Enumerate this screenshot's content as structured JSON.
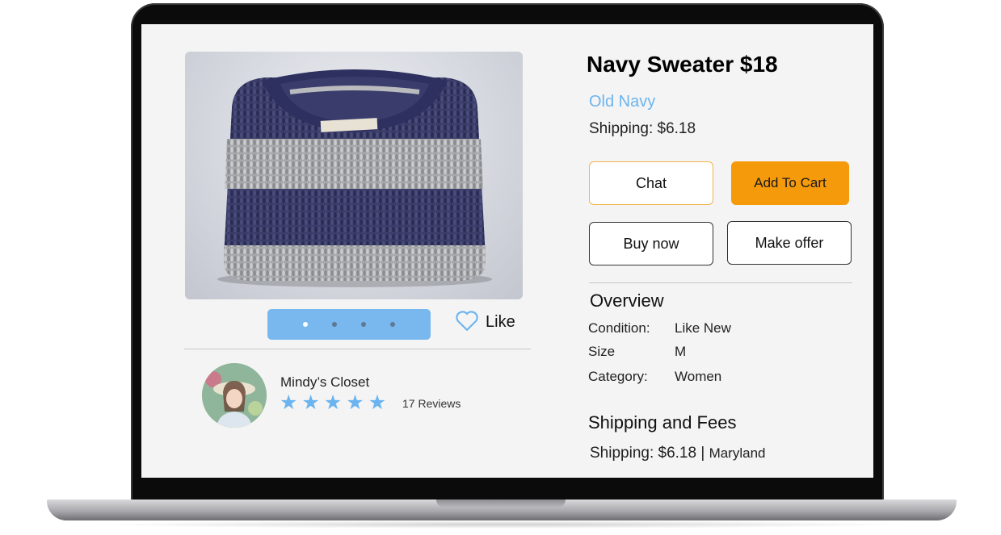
{
  "product": {
    "title": "Navy Sweater $18",
    "brand": "Old Navy",
    "shipping_line": "Shipping: $6.18"
  },
  "actions": {
    "chat": "Chat",
    "add_to_cart": "Add To Cart",
    "buy_now": "Buy now",
    "make_offer": "Make offer",
    "like": "Like"
  },
  "carousel": {
    "total": 4,
    "active_index": 0
  },
  "seller": {
    "name": "Mindy’s Closet",
    "rating": 5,
    "reviews": "17 Reviews"
  },
  "overview": {
    "title": "Overview",
    "specs": [
      {
        "label": "Condition:",
        "value": "Like New"
      },
      {
        "label": "Size",
        "value": "M"
      },
      {
        "label": "Category:",
        "value": "Women"
      }
    ]
  },
  "shipping_fees": {
    "title": "Shipping and Fees",
    "shipping": "Shipping: $6.18",
    "separator": "|",
    "location": "Maryland"
  },
  "colors": {
    "accent_blue": "#6bb4ef",
    "cart_orange": "#f59a0b",
    "dots_bar": "#78b8ee"
  },
  "icons": [
    "heart-icon",
    "star-icon"
  ]
}
